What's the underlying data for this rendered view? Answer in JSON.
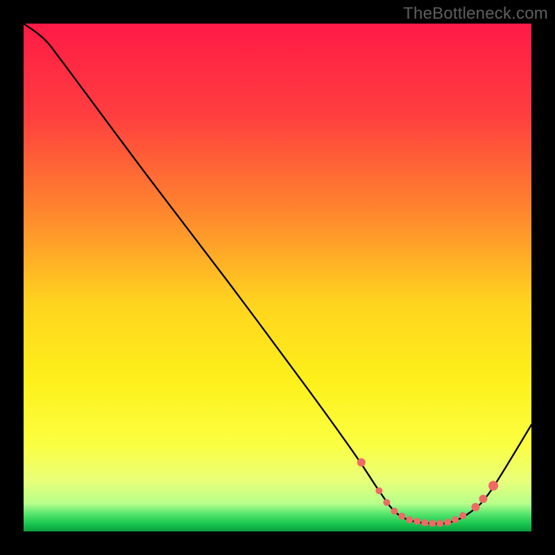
{
  "watermark": "TheBottleneck.com",
  "chart_data": {
    "type": "line",
    "title": "",
    "xlabel": "",
    "ylabel": "",
    "xlim": [
      0,
      100
    ],
    "ylim": [
      0,
      100
    ],
    "gradient_stops": [
      {
        "offset": 0.0,
        "color": "#ff1a46"
      },
      {
        "offset": 0.18,
        "color": "#ff3e3f"
      },
      {
        "offset": 0.38,
        "color": "#ff8a2d"
      },
      {
        "offset": 0.55,
        "color": "#ffd41f"
      },
      {
        "offset": 0.7,
        "color": "#fef01a"
      },
      {
        "offset": 0.83,
        "color": "#fbff42"
      },
      {
        "offset": 0.9,
        "color": "#e9ff79"
      },
      {
        "offset": 0.945,
        "color": "#b7ff8b"
      },
      {
        "offset": 0.965,
        "color": "#58e66e"
      },
      {
        "offset": 0.985,
        "color": "#19c64f"
      },
      {
        "offset": 1.0,
        "color": "#0a9e3e"
      }
    ],
    "series": [
      {
        "name": "bottleneck-curve",
        "x": [
          0,
          4,
          8,
          24,
          40,
          56,
          65,
          70,
          73,
          76,
          80,
          84,
          88,
          92,
          100
        ],
        "y": [
          100,
          97,
          92,
          70.5,
          49.5,
          28,
          15.5,
          8,
          4,
          2.2,
          1.6,
          1.8,
          3.8,
          8,
          21
        ]
      }
    ],
    "markers": {
      "name": "highlight-points",
      "color": "#ee6a66",
      "points": [
        {
          "x": 66.5,
          "y": 13.6,
          "r": 6
        },
        {
          "x": 70.0,
          "y": 8.0,
          "r": 5
        },
        {
          "x": 71.5,
          "y": 5.7,
          "r": 5
        },
        {
          "x": 73.0,
          "y": 4.0,
          "r": 5
        },
        {
          "x": 74.5,
          "y": 3.0,
          "r": 5
        },
        {
          "x": 76.0,
          "y": 2.3,
          "r": 5
        },
        {
          "x": 77.5,
          "y": 2.0,
          "r": 5
        },
        {
          "x": 79.0,
          "y": 1.7,
          "r": 5
        },
        {
          "x": 80.5,
          "y": 1.6,
          "r": 5
        },
        {
          "x": 82.0,
          "y": 1.6,
          "r": 5
        },
        {
          "x": 83.5,
          "y": 1.8,
          "r": 5
        },
        {
          "x": 85.0,
          "y": 2.3,
          "r": 5
        },
        {
          "x": 86.5,
          "y": 3.1,
          "r": 5
        },
        {
          "x": 89.0,
          "y": 4.8,
          "r": 6
        },
        {
          "x": 90.5,
          "y": 6.4,
          "r": 6
        },
        {
          "x": 92.5,
          "y": 9.0,
          "r": 7
        }
      ]
    }
  }
}
